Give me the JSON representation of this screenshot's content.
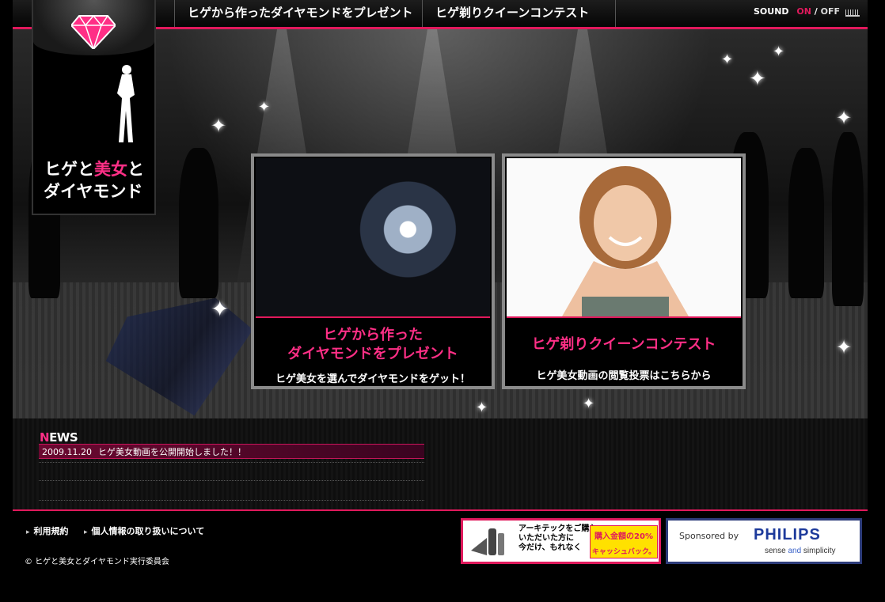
{
  "nav": {
    "items": [
      {
        "label": "ヒゲから作ったダイヤモンドをプレゼント"
      },
      {
        "label": "ヒゲ剃りクイーンコンテスト"
      }
    ],
    "sound": {
      "label": "SOUND",
      "on": "ON",
      "separator": "/",
      "off": "OFF"
    }
  },
  "logo": {
    "line1_a": "ヒゲと",
    "line1_b": "美女",
    "line1_c": "と",
    "line2": "ダイヤモンド"
  },
  "cards": [
    {
      "title_line1": "ヒゲから作った",
      "title_line2": "ダイヤモンドをプレゼント",
      "subtitle": "ヒゲ美女を選んでダイヤモンドをゲット！"
    },
    {
      "title_line1": "ヒゲ剃りクイーンコンテスト",
      "subtitle": "ヒゲ美女動画の閲覧投票はこちらから"
    }
  ],
  "news": {
    "header_first": "N",
    "header_rest": "EWS",
    "items": [
      {
        "date": "2009.11.20",
        "text": "ヒゲ美女動画を公開開始しました！！"
      }
    ]
  },
  "footer": {
    "links": [
      {
        "label": "利用規約"
      },
      {
        "label": "個人情報の取り扱いについて"
      }
    ],
    "copyright": "© ヒゲと美女とダイヤモンド実行委員会"
  },
  "banners": {
    "arch": {
      "text": "アーキテックをご購入\nいただいた方に\n今だけ、もれなく",
      "badge_top": "購入金額の20%",
      "badge_bottom": "キャッシュバック。"
    },
    "philips": {
      "sponsor": "Sponsored by",
      "brand": "PHILIPS",
      "tag_a": "sense ",
      "tag_and": "and",
      "tag_b": " simplicity"
    }
  },
  "colors": {
    "accent": "#e0195c",
    "pink_text": "#ff2f86",
    "philips_blue": "#1d3a9b"
  }
}
